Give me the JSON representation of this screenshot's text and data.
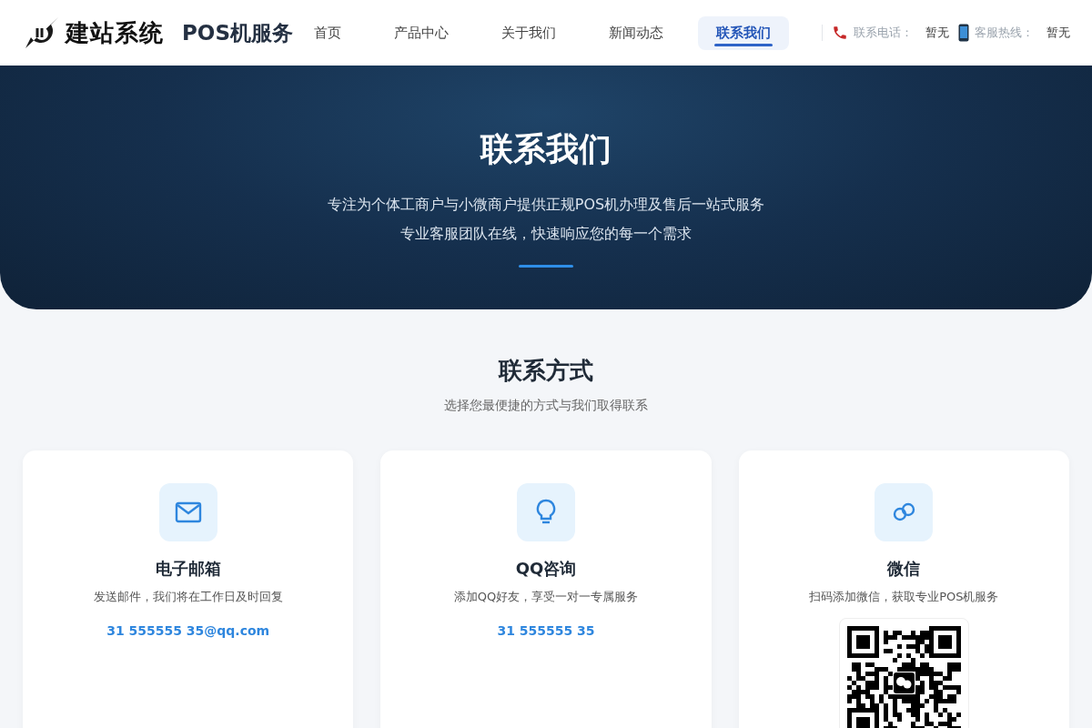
{
  "header": {
    "logo_text": "建站系统",
    "site_name": "POS机服务",
    "nav": [
      {
        "label": "首页",
        "selected": false
      },
      {
        "label": "产品中心",
        "selected": false
      },
      {
        "label": "关于我们",
        "selected": false
      },
      {
        "label": "新闻动态",
        "selected": false
      },
      {
        "label": "联系我们",
        "selected": true
      }
    ],
    "contacts": [
      {
        "kind": "phone",
        "label": "联系电话：",
        "value": "暂无"
      },
      {
        "kind": "mobile",
        "label": "客服热线：",
        "value": "暂无"
      }
    ]
  },
  "hero": {
    "title": "联系我们",
    "lines": [
      "专注为个体工商户与小微商户提供正规POS机办理及售后一站式服务",
      "专业客服团队在线，快速响应您的每一个需求"
    ]
  },
  "section": {
    "title": "联系方式",
    "subtitle": "选择您最便捷的方式与我们取得联系"
  },
  "cards": [
    {
      "kind": "email",
      "title": "电子邮箱",
      "description": "发送邮件，我们将在工作日及时回复",
      "contact": "31 555555 35@qq.com"
    },
    {
      "kind": "qq",
      "title": "QQ咨询",
      "description": "添加QQ好友，享受一对一专属服务",
      "contact": "31 555555 35"
    },
    {
      "kind": "wechat",
      "title": "微信",
      "description": "扫码添加微信，获取专业POS机服务"
    }
  ]
}
